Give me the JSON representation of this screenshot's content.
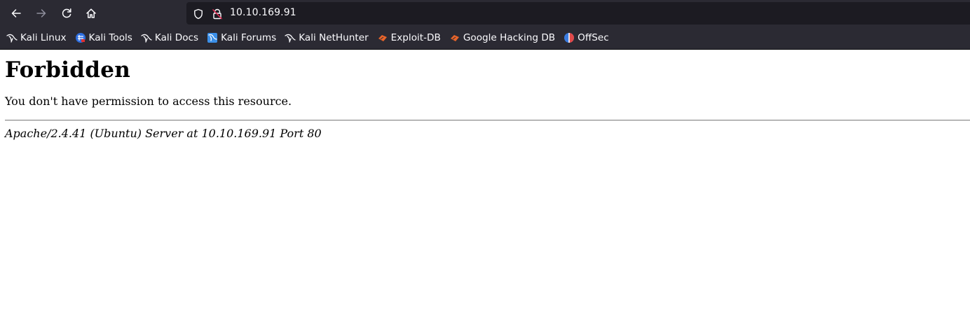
{
  "browser": {
    "url": "10.10.169.91",
    "colors": {
      "toolbar": "#2b2a33",
      "urlbar": "#1c1b22",
      "text": "#fbfbfe",
      "insecure_lock": "#e22850"
    },
    "nav": {
      "back_icon": "arrow-left-icon",
      "forward_icon": "arrow-right-icon",
      "reload_icon": "reload-icon",
      "home_icon": "home-icon"
    },
    "bookmarks": [
      {
        "label": "Kali Linux",
        "icon": "kali-dragon-icon"
      },
      {
        "label": "Kali Tools",
        "icon": "kali-tools-icon"
      },
      {
        "label": "Kali Docs",
        "icon": "kali-dragon-icon"
      },
      {
        "label": "Kali Forums",
        "icon": "kali-forums-icon"
      },
      {
        "label": "Kali NetHunter",
        "icon": "kali-dragon-icon"
      },
      {
        "label": "Exploit-DB",
        "icon": "exploit-db-icon"
      },
      {
        "label": "Google Hacking DB",
        "icon": "exploit-db-icon"
      },
      {
        "label": "OffSec",
        "icon": "offsec-icon"
      }
    ]
  },
  "page": {
    "heading": "Forbidden",
    "message": "You don't have permission to access this resource.",
    "server_signature": "Apache/2.4.41 (Ubuntu) Server at 10.10.169.91 Port 80"
  }
}
